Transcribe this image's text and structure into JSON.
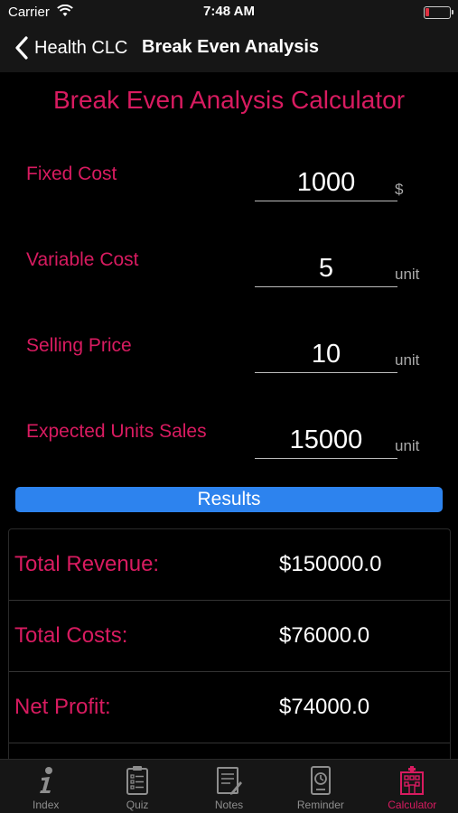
{
  "status": {
    "carrier": "Carrier",
    "time": "7:48 AM"
  },
  "nav": {
    "back_label": "Health CLC",
    "title": "Break Even Analysis"
  },
  "calculator": {
    "title": "Break Even Analysis Calculator",
    "fields": [
      {
        "label": "Fixed Cost",
        "value": "1000",
        "unit": "$"
      },
      {
        "label": "Variable Cost",
        "value": "5",
        "unit": "unit"
      },
      {
        "label": "Selling Price",
        "value": "10",
        "unit": "unit"
      },
      {
        "label": "Expected Units Sales",
        "value": "15000",
        "unit": "unit"
      }
    ],
    "results_button": "Results"
  },
  "results": [
    {
      "label": "Total Revenue:",
      "value": "$150000.0"
    },
    {
      "label": "Total Costs:",
      "value": "$76000.0"
    },
    {
      "label": "Net Profit:",
      "value": "$74000.0"
    }
  ],
  "tabs": [
    {
      "label": "Index",
      "icon": "info-icon",
      "active": false
    },
    {
      "label": "Quiz",
      "icon": "clipboard-icon",
      "active": false
    },
    {
      "label": "Notes",
      "icon": "notes-icon",
      "active": false
    },
    {
      "label": "Reminder",
      "icon": "clock-icon",
      "active": false
    },
    {
      "label": "Calculator",
      "icon": "hospital-icon",
      "active": true
    }
  ],
  "colors": {
    "accent": "#d81b60",
    "button": "#2d83ee",
    "background": "#000000",
    "bar": "#161616"
  }
}
